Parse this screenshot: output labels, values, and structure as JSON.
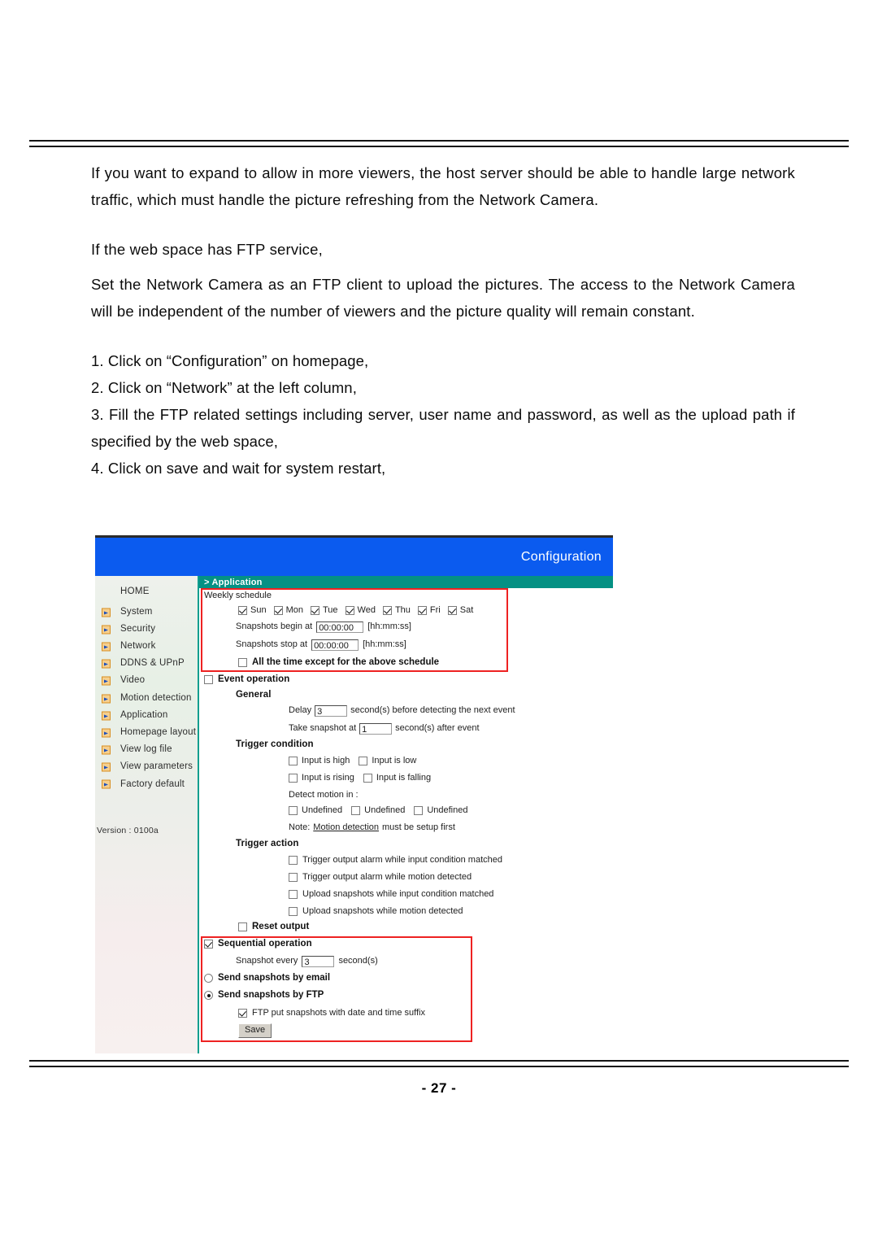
{
  "document": {
    "page_number": "- 27 -",
    "paragraphs": [
      "If you want to expand to allow in more viewers, the host server should be able to handle large network traffic, which must handle the picture refreshing from the Network Camera.",
      "If the web space has FTP service,",
      "Set the Network Camera as an FTP client to upload the pictures. The access to the Network Camera will be independent of the number of viewers and the picture quality will remain constant."
    ],
    "steps": [
      "1. Click on “Configuration” on homepage,",
      "2. Click on “Network” at the left column,",
      "3. Fill the FTP related settings including server, user name and password, as well as the upload path if specified by the web space,",
      "4. Click on save and wait for system restart,"
    ]
  },
  "camera_ui": {
    "header": {
      "title": "Configuration"
    },
    "breadcrumb": {
      "label": "> Application"
    },
    "sidebar": {
      "home_label": "HOME",
      "items": [
        {
          "label": "System"
        },
        {
          "label": "Security"
        },
        {
          "label": "Network"
        },
        {
          "label": "DDNS & UPnP"
        },
        {
          "label": "Video"
        },
        {
          "label": "Motion detection"
        },
        {
          "label": "Application"
        },
        {
          "label": "Homepage layout"
        },
        {
          "label": "View log file"
        },
        {
          "label": "View parameters"
        },
        {
          "label": "Factory default"
        }
      ],
      "version": "Version : 0100a"
    },
    "weekly_schedule": {
      "title": "Weekly schedule",
      "days": [
        {
          "label": "Sun",
          "checked": true
        },
        {
          "label": "Mon",
          "checked": true
        },
        {
          "label": "Tue",
          "checked": true
        },
        {
          "label": "Wed",
          "checked": true
        },
        {
          "label": "Thu",
          "checked": true
        },
        {
          "label": "Fri",
          "checked": true
        },
        {
          "label": "Sat",
          "checked": true
        }
      ],
      "begin_label": "Snapshots begin at",
      "begin_value": "00:00:00",
      "begin_format": "[hh:mm:ss]",
      "stop_label": "Snapshots stop at",
      "stop_value": "00:00:00",
      "stop_format": "[hh:mm:ss]",
      "all_time_label": "All the time except for the above schedule",
      "all_time_checked": false
    },
    "event_operation": {
      "title": "Event operation",
      "checked": false,
      "general_title": "General",
      "delay_prefix": "Delay",
      "delay_value": "3",
      "delay_suffix": "second(s) before detecting the next event",
      "snapshot_prefix": "Take snapshot at",
      "snapshot_value": "1",
      "snapshot_suffix": "second(s) after event",
      "trigger_condition_title": "Trigger condition",
      "conditions": [
        {
          "label": "Input is high",
          "checked": false
        },
        {
          "label": "Input is low",
          "checked": false
        },
        {
          "label": "Input is rising",
          "checked": false
        },
        {
          "label": "Input is falling",
          "checked": false
        }
      ],
      "detect_motion_label": "Detect motion in :",
      "motion_windows": [
        {
          "label": "Undefined",
          "checked": false
        },
        {
          "label": "Undefined",
          "checked": false
        },
        {
          "label": "Undefined",
          "checked": false
        }
      ],
      "note_prefix": "Note:",
      "note_link": "Motion detection",
      "note_suffix": "must be setup first",
      "trigger_action_title": "Trigger action",
      "actions": [
        {
          "label": "Trigger output alarm while input condition matched",
          "checked": false
        },
        {
          "label": "Trigger output alarm while motion detected",
          "checked": false
        },
        {
          "label": "Upload snapshots while input condition matched",
          "checked": false
        },
        {
          "label": "Upload snapshots while motion detected",
          "checked": false
        }
      ],
      "reset_output_label": "Reset output",
      "reset_output_checked": false
    },
    "sequential_operation": {
      "title": "Sequential operation",
      "checked": true,
      "snapshot_prefix": "Snapshot every",
      "snapshot_value": "3",
      "snapshot_suffix": "second(s)",
      "send_email_label": "Send snapshots by email",
      "send_email_selected": false,
      "send_ftp_label": "Send snapshots by FTP",
      "send_ftp_selected": true,
      "ftp_suffix_label": "FTP put snapshots with date and time suffix",
      "ftp_suffix_checked": true,
      "save_label": "Save"
    },
    "colors": {
      "header_blue": "#0b5bef",
      "breadcrumb_teal": "#049184",
      "highlight_red": "#ee2222",
      "arrow_orange": "#f5cf8e"
    }
  }
}
